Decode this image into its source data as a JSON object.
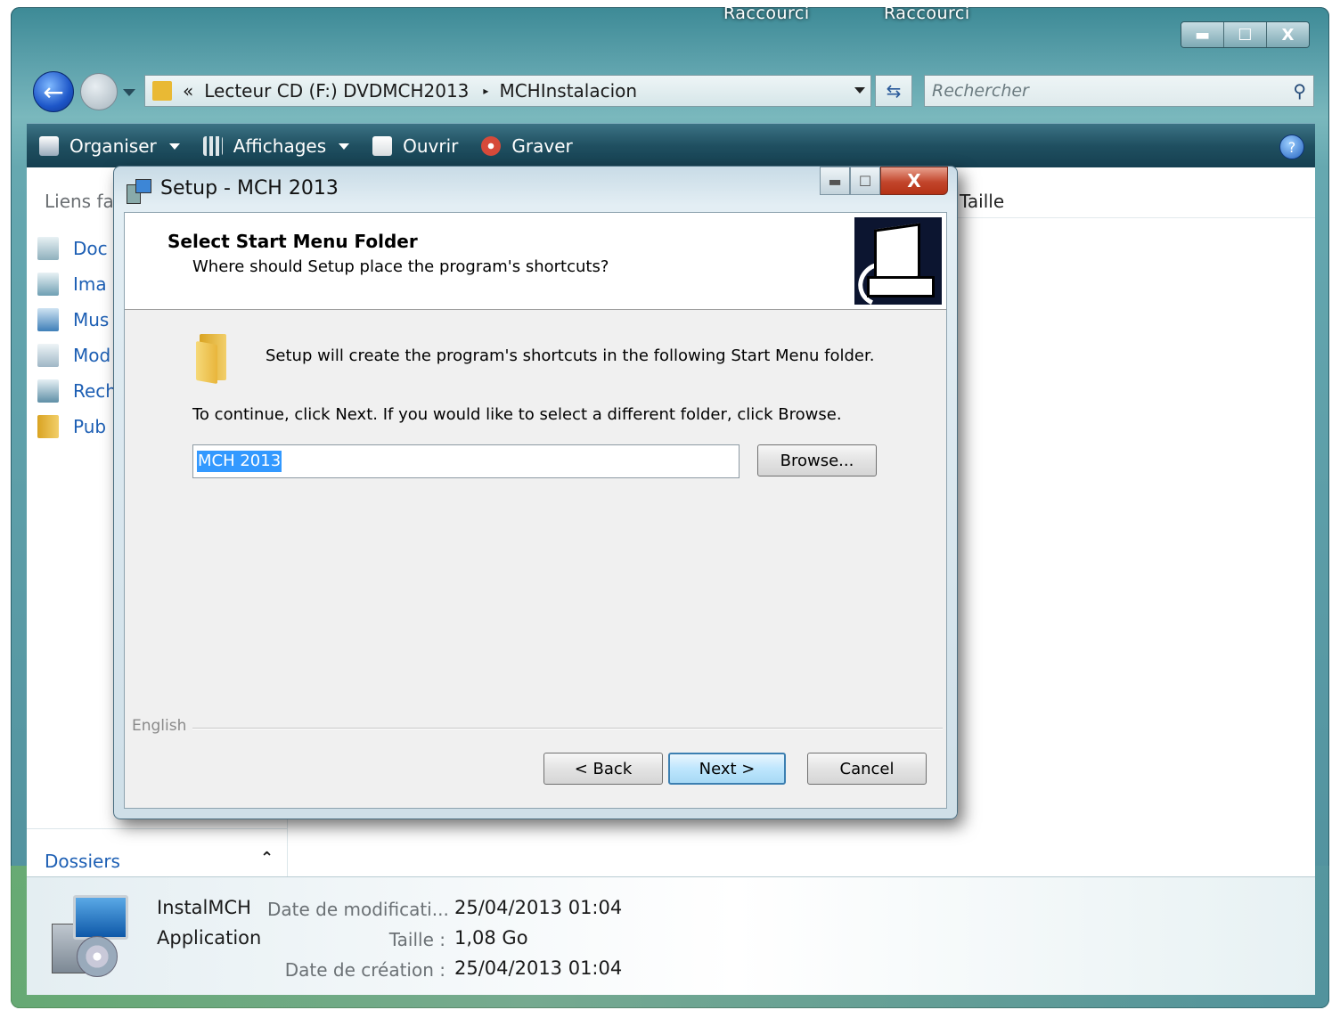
{
  "explorer": {
    "top_labels": [
      "Raccourci",
      "Raccourci"
    ],
    "window_controls": {
      "minimize": "▬",
      "maximize": "☐",
      "close": "X"
    },
    "address": {
      "prefix": "«",
      "segments": [
        "Lecteur CD (F:) DVDMCH2013",
        "MCHInstalacion"
      ],
      "separator": "▸"
    },
    "search_placeholder": "Rechercher",
    "toolbar": {
      "organiser": "Organiser",
      "affichages": "Affichages",
      "ouvrir": "Ouvrir",
      "graver": "Graver",
      "help": "?"
    },
    "left_pane": {
      "title": "Liens fa",
      "items": [
        "Doc",
        "Ima",
        "Mus",
        "Mod",
        "Rech",
        "Pub"
      ]
    },
    "dossiers_label": "Dossiers",
    "column_header": "Taille",
    "details": {
      "name": "InstalMCH",
      "type": "Application",
      "modified_label": "Date de modificati...",
      "modified_value": "25/04/2013 01:04",
      "size_label": "Taille :",
      "size_value": "1,08 Go",
      "created_label": "Date de création :",
      "created_value": "25/04/2013 01:04"
    }
  },
  "dialog": {
    "title": "Setup - MCH 2013",
    "heading": "Select Start Menu Folder",
    "subheading": "Where should Setup place the program's shortcuts?",
    "line1": "Setup will create the program's shortcuts in the following Start Menu folder.",
    "line2": "To continue, click Next. If you would like to select a different folder, click Browse.",
    "folder_value": "MCH 2013",
    "browse_label": "Browse...",
    "language": "English",
    "back_label": "< Back",
    "next_label": "Next >",
    "cancel_label": "Cancel",
    "close_glyph": "X"
  },
  "colors": {
    "link_blue": "#1d5fb4",
    "selection": "#3399ff",
    "toolbar_dark": "#1f4f60"
  }
}
